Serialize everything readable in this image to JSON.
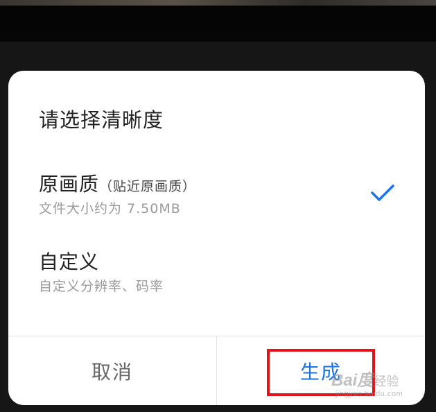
{
  "dialog": {
    "title": "请选择清晰度",
    "options": [
      {
        "label": "原画质",
        "note": "（贴近原画质）",
        "sub": "文件大小约为 7.50MB",
        "selected": true
      },
      {
        "label": "自定义",
        "sub": "自定义分辨率、码率",
        "selected": false
      }
    ],
    "buttons": {
      "cancel": "取消",
      "confirm": "生成"
    }
  },
  "watermark": {
    "logo": "Bai",
    "paw": "度",
    "cn": "经验",
    "url": "jingyan.baidu.com"
  },
  "colors": {
    "accent": "#1a73e8",
    "highlight": "#e0141a",
    "sheet": "#ffffff"
  },
  "icons": {
    "selected_indicator": "checkmark-icon",
    "watermark_paw": "paw-icon"
  }
}
